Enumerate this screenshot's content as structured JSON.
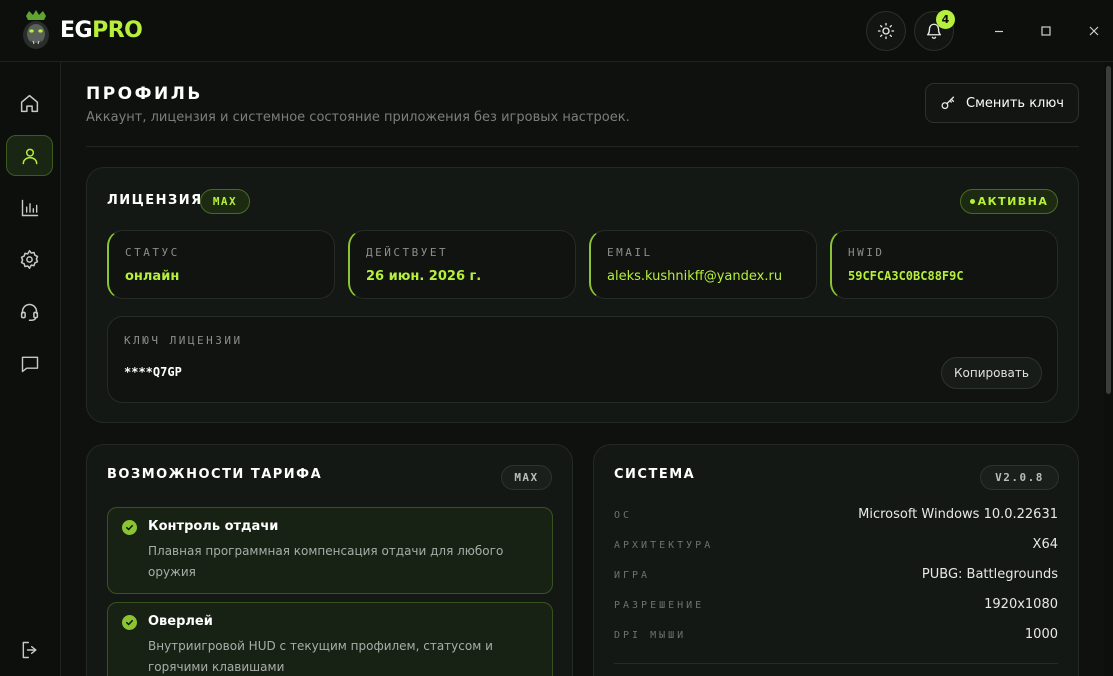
{
  "app": {
    "brand_eg": "EG",
    "brand_pro": "PRO",
    "notification_count": "4"
  },
  "colors": {
    "accent": "#b6f03c",
    "accent_dark": "#8ac432",
    "background": "#0f110f",
    "card": "#141814"
  },
  "sidebar": {
    "items": [
      {
        "name": "home-icon"
      },
      {
        "name": "profile-icon",
        "active": true
      },
      {
        "name": "stats-icon"
      },
      {
        "name": "settings-icon"
      },
      {
        "name": "support-icon"
      },
      {
        "name": "chat-icon"
      },
      {
        "name": "logout-icon"
      }
    ]
  },
  "header": {
    "title": "ПРОФИЛЬ",
    "subtitle": "Аккаунт, лицензия и системное состояние приложения без игровых настроек.",
    "change_key_label": "Сменить ключ"
  },
  "license": {
    "title": "ЛИЦЕНЗИЯ",
    "tier": "MAX",
    "status_badge": "АКТИВНА",
    "fields": [
      {
        "label": "СТАТУС",
        "value": "онлайн"
      },
      {
        "label": "ДЕЙСТВУЕТ",
        "value": "26 июн. 2026 г."
      },
      {
        "label": "EMAIL",
        "value": "aleks.kushnikff@yandex.ru"
      },
      {
        "label": "HWID",
        "value": "59CFCA3C0BC88F9C"
      }
    ],
    "key_label": "КЛЮЧ ЛИЦЕНЗИИ",
    "key_value": "****Q7GP",
    "copy_label": "Копировать"
  },
  "features": {
    "title": "ВОЗМОЖНОСТИ ТАРИФА",
    "tier": "MAX",
    "items": [
      {
        "title": "Контроль отдачи",
        "desc": "Плавная программная компенсация отдачи для любого оружия"
      },
      {
        "title": "Оверлей",
        "desc": "Внутриигровой HUD с текущим профилем, статусом и горячими клавишами"
      }
    ]
  },
  "system": {
    "title": "СИСТЕМА",
    "version": "V2.0.8",
    "rows": [
      {
        "label": "ОС",
        "value": "Microsoft Windows 10.0.22631"
      },
      {
        "label": "АРХИТЕКТУРА",
        "value": "X64"
      },
      {
        "label": "ИГРА",
        "value": "PUBG: Battlegrounds"
      },
      {
        "label": "РАЗРЕШЕНИЕ",
        "value": "1920x1080"
      },
      {
        "label": "DPI МЫШИ",
        "value": "1000"
      }
    ]
  }
}
